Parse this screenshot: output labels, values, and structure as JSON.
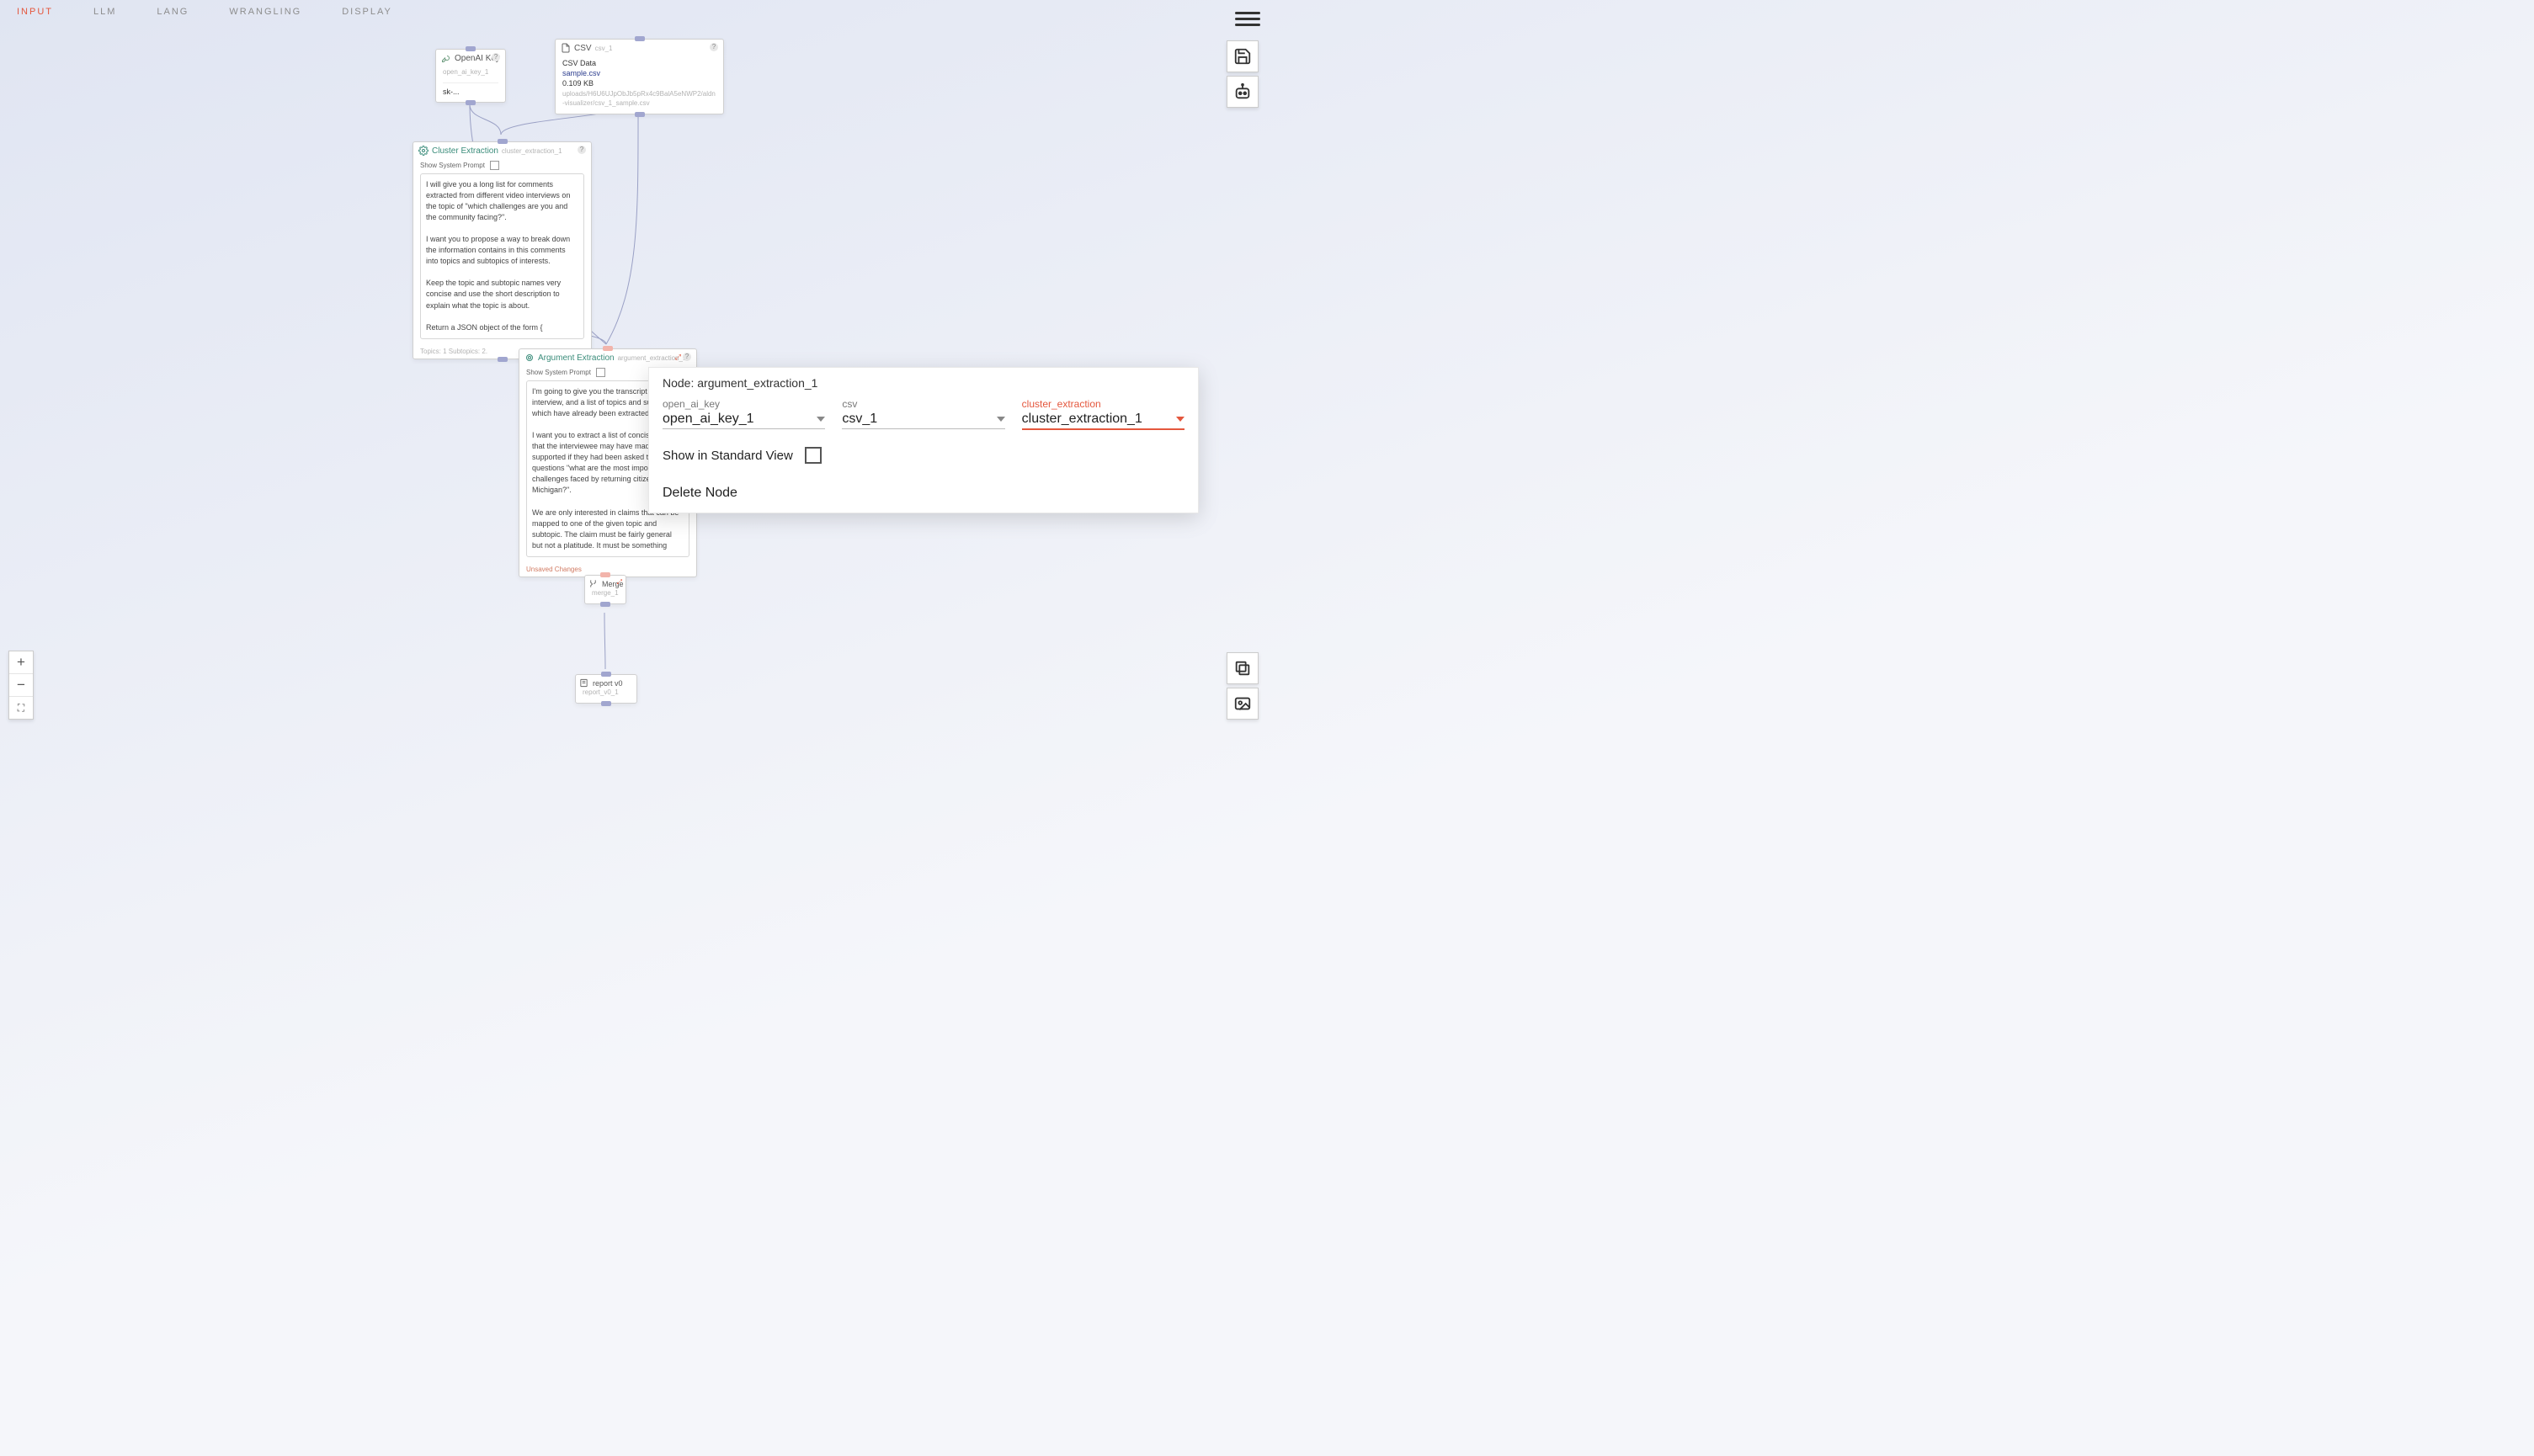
{
  "menu": {
    "items": [
      "INPUT",
      "LLM",
      "LANG",
      "WRANGLING",
      "DISPLAY"
    ],
    "active_index": 0
  },
  "nodes": {
    "openai": {
      "title": "OpenAI Key",
      "id": "open_ai_key_1",
      "value": "sk-..."
    },
    "csv": {
      "title": "CSV",
      "id": "csv_1",
      "line_data": "CSV Data",
      "filename": "sample.csv",
      "size": "0.109 KB",
      "path": "uploads/H6U6UJpObJb5pRx4c9BalA5eNWP2/aldn-visualizer/csv_1_sample.csv"
    },
    "cluster": {
      "title": "Cluster Extraction",
      "id": "cluster_extraction_1",
      "show_sys": "Show System Prompt",
      "text": "I will give you a long list for comments extracted from different video interviews on the topic of \"which challenges are you and the community facing?\".\n\nI want you to propose a way to break down the information contains in this comments into topics and subtopics of interests.\n\nKeep the topic and subtopic names very concise and use the short description to explain what the topic is about.\n\nReturn a JSON object of the form {",
      "footer": "Topics: 1 Subtopics: 2."
    },
    "argument": {
      "title": "Argument Extraction",
      "id": "argument_extraction_1",
      "show_sys": "Show System Prompt",
      "text": "I'm going to give you the transcript of a video interview, and a list of topics and subtopics which have already been extracted.\n\nI want you to extract a list of concise claims that the interviewee may have made or supported if they had been asked the questions \"what are the most important challenges faced by returning citizens in Michigan?\".\n\nWe are only interested in claims that can be mapped to one of the given topic and subtopic. The claim must be fairly general but not a platitude. It must be something",
      "footer": "Unsaved Changes"
    },
    "merge": {
      "title": "Merge",
      "id": "merge_1"
    },
    "report": {
      "title": "report v0",
      "id": "report_v0_1"
    }
  },
  "panel": {
    "title": "Node: argument_extraction_1",
    "fields": [
      {
        "label": "open_ai_key",
        "value": "open_ai_key_1",
        "accent": false
      },
      {
        "label": "csv",
        "value": "csv_1",
        "accent": false
      },
      {
        "label": "cluster_extraction",
        "value": "cluster_extraction_1",
        "accent": true
      }
    ],
    "standard_view": "Show in Standard View",
    "delete": "Delete Node"
  },
  "zoom": {
    "plus": "+",
    "minus": "−",
    "fit": "⛶"
  },
  "icons": {
    "save": "save",
    "robot": "robot",
    "layers": "layers",
    "pic": "image",
    "burger": "menu"
  }
}
